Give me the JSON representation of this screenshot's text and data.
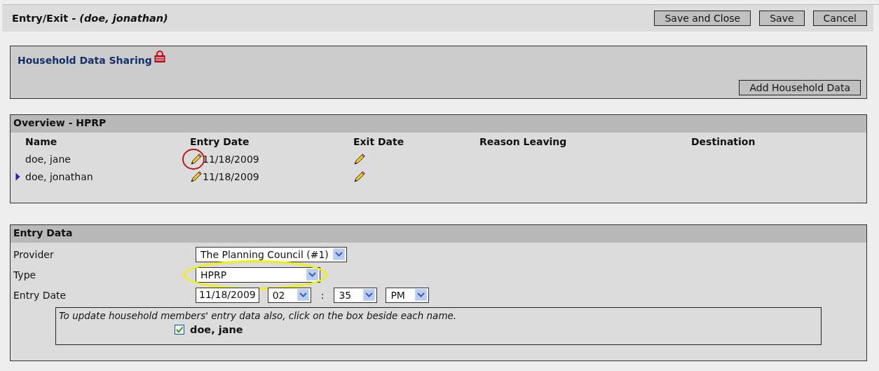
{
  "window": {
    "title": "Entry/Exit - *(doe, jonathan)*"
  },
  "toolbar_buttons": [
    "Save and Close",
    "Save",
    "Cancel"
  ],
  "household": {
    "title": "Household Data Sharing",
    "locked": true,
    "button": "Add Household Data"
  },
  "overview": {
    "title": "Overview - HPRP",
    "columns": [
      "Name",
      "Entry Date",
      "Exit Date",
      "Reason Leaving",
      "Destination"
    ],
    "rows": [
      {
        "name": "doe, jane",
        "selected": false,
        "entry_date": "11/18/2009",
        "entry_circled": true
      },
      {
        "name": "doe, jonathan",
        "selected": true,
        "entry_date": "11/18/2009",
        "entry_circled": false
      }
    ]
  },
  "entry_data": {
    "title": "Entry Data",
    "fields": [
      {
        "kind": "select",
        "label": "Provider",
        "value": "The Planning Council (#1)",
        "highlighted": false
      },
      {
        "kind": "select",
        "label": "Type",
        "value": "HPRP",
        "highlighted": true
      },
      {
        "kind": "datetime",
        "label": "Entry Date",
        "date": "11/18/2009",
        "hour": "02",
        "separator": ":",
        "minute": "35",
        "ampm": "PM",
        "highlighted": false
      }
    ],
    "notice": "To update household members' entry data also, click on the box beside each name.",
    "members": [
      {
        "name": "doe, jane",
        "checked": true
      }
    ]
  }
}
